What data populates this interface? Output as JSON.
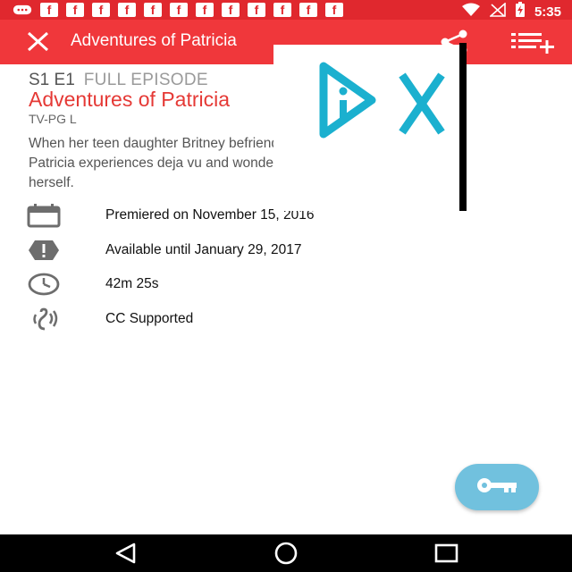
{
  "status_bar": {
    "time": "5:35",
    "notification_icons": [
      "game-controller-icon",
      "facebook-icon",
      "facebook-icon",
      "facebook-icon",
      "facebook-icon",
      "facebook-icon",
      "facebook-icon",
      "facebook-icon",
      "facebook-icon",
      "facebook-icon",
      "facebook-icon",
      "facebook-icon",
      "facebook-icon"
    ],
    "facebook_glyph": "f"
  },
  "app_bar": {
    "title": "Adventures of Patricia",
    "icons": {
      "close": "close-icon",
      "share": "share-icon",
      "queue": "add-to-queue-icon"
    }
  },
  "episode": {
    "season_episode": "S1 E1",
    "label": "FULL EPISODE",
    "title": "Adventures of Patricia",
    "rating": "TV-PG L",
    "description": "When her teen daughter Britney befriends the queen bee at school, Patricia experiences deja vu and wonders if she's turning into her mom herself."
  },
  "info_rows": [
    {
      "icon": "calendar-icon",
      "text": "Premiered on November 15, 2016"
    },
    {
      "icon": "alert-icon",
      "text": "Available until January 29, 2017"
    },
    {
      "icon": "clock-icon",
      "text": "42m 25s"
    },
    {
      "icon": "closed-caption-ear-icon",
      "text": "CC Supported"
    }
  ],
  "overlay_ad": {
    "icons": [
      "ad-choices-icon",
      "ad-close-icon"
    ]
  },
  "fab": {
    "icon": "key-icon"
  },
  "nav_bar": {
    "icons": [
      "back-icon",
      "home-icon",
      "recents-icon"
    ]
  },
  "colors": {
    "status_bar": "#e0282e",
    "app_bar": "#f0373b",
    "accent": "#e53935",
    "fab": "#71c1de",
    "overlay_icon": "#1bb0cf"
  }
}
